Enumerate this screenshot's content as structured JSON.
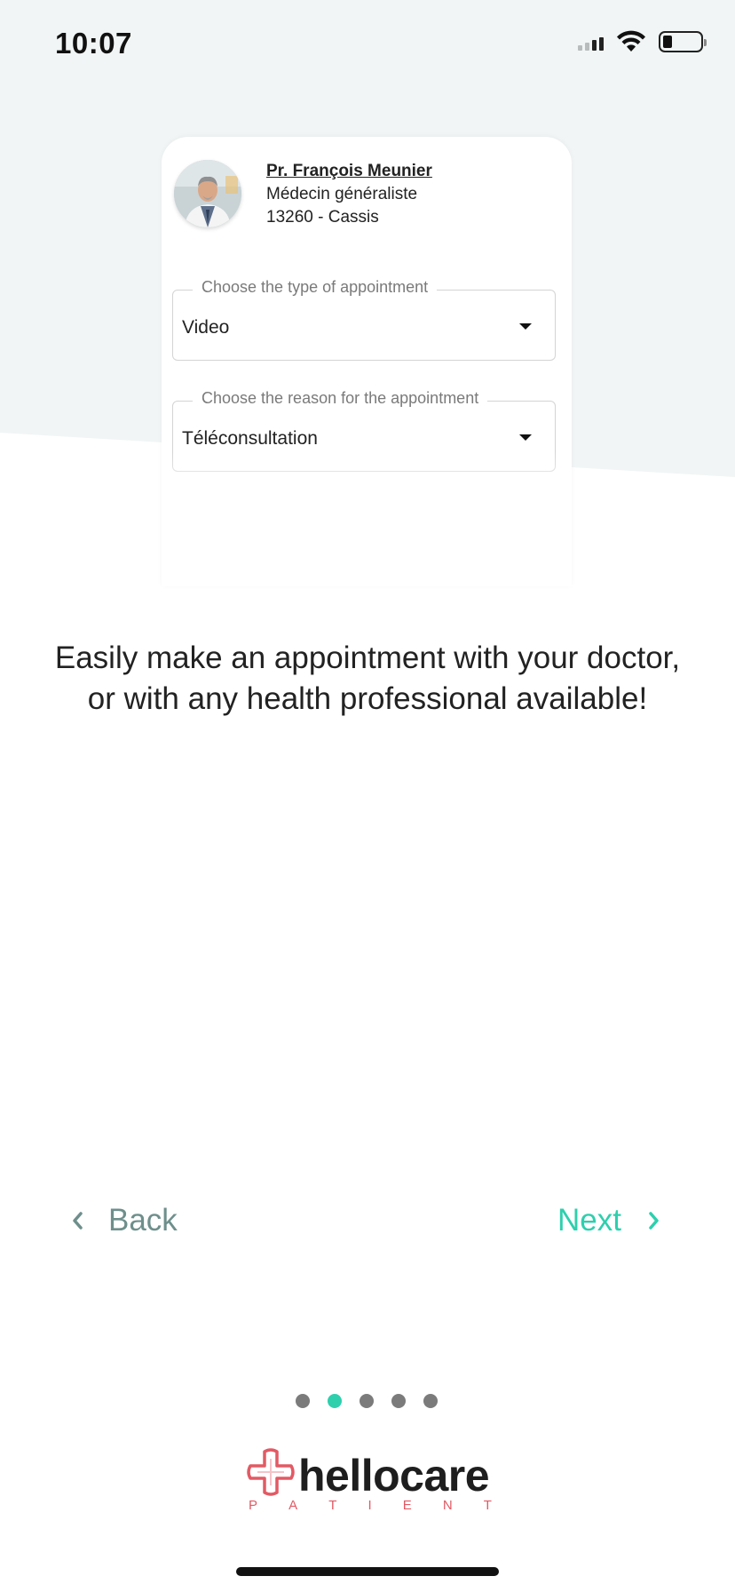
{
  "status_bar": {
    "time": "10:07"
  },
  "card": {
    "doctor": {
      "name": "Pr. François  Meunier",
      "specialty": "Médecin généraliste",
      "location": "13260 - Cassis"
    },
    "appointment_type": {
      "label": "Choose the type of appointment",
      "value": "Video"
    },
    "appointment_reason": {
      "label": "Choose the reason for the appointment",
      "value": "Téléconsultation"
    }
  },
  "headline": "Easily make an appointment with your doctor, or with any health professional available!",
  "nav": {
    "back_label": "Back",
    "next_label": "Next"
  },
  "pager": {
    "total": 5,
    "current": 2
  },
  "logo": {
    "word": "hellocare",
    "sub_letters": [
      "P",
      "A",
      "T",
      "I",
      "E",
      "N",
      "T"
    ]
  },
  "colors": {
    "accent": "#2ecfad",
    "muted_nav": "#6e8f8c",
    "background_panel": "#f1f5f5",
    "logo_red": "#e25a64"
  }
}
